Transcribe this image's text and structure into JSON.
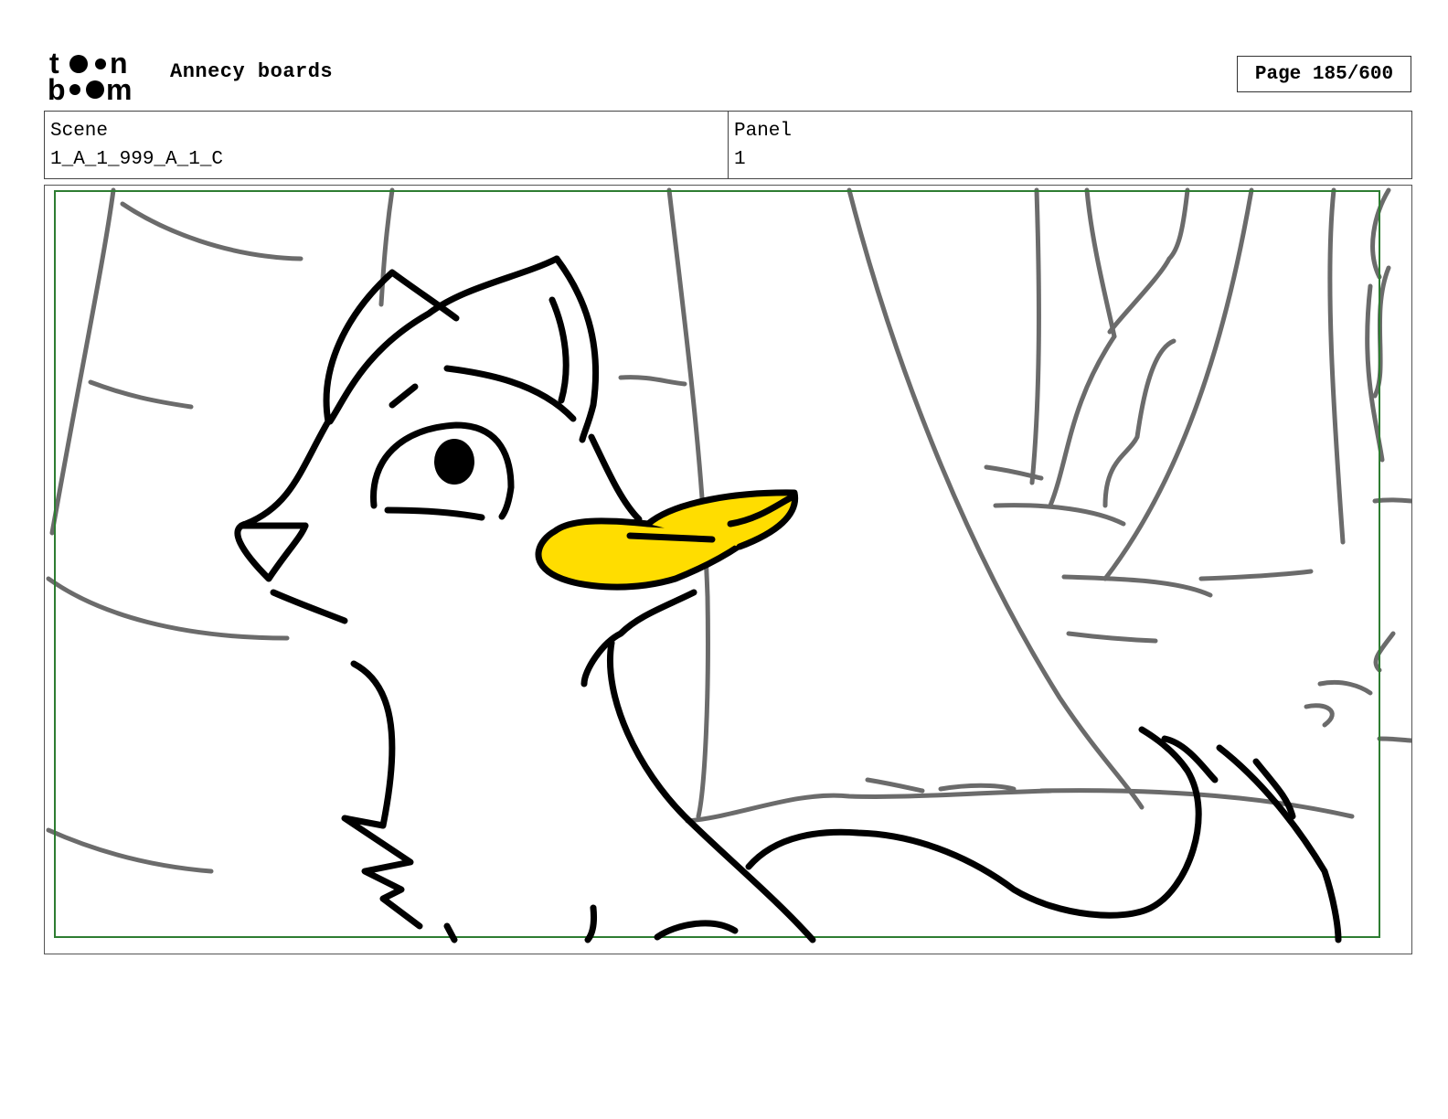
{
  "header": {
    "app_title": "Annecy boards",
    "page_label": "Page 185/600"
  },
  "logo": {
    "line1": "toon",
    "line2": "boom"
  },
  "info": {
    "scene_label": "Scene",
    "scene_value": "1_A_1_999_A_1_C",
    "panel_label": "Panel",
    "panel_value": "1"
  },
  "colors": {
    "safe_frame": "#2e7d32",
    "background_lines": "#6b6b6b",
    "character_lines": "#000000",
    "beak_fill": "#ffdd00"
  }
}
